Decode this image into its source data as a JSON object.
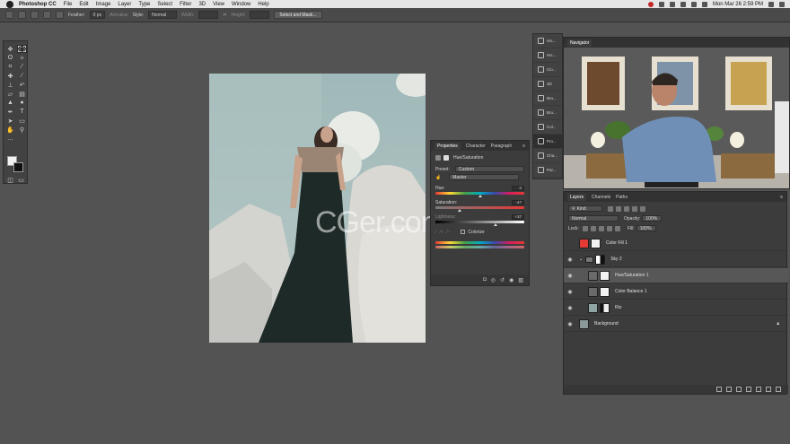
{
  "menubar": {
    "app_name": "Photoshop CC",
    "menus": [
      "File",
      "Edit",
      "Image",
      "Layer",
      "Type",
      "Select",
      "Filter",
      "3D",
      "View",
      "Window",
      "Help"
    ],
    "clock": "Mon Mar 26  2:59 PM"
  },
  "options": {
    "feather_label": "Feather:",
    "feather_value": "0 px",
    "antialias_label": "Anti-alias",
    "style_label": "Style:",
    "style_value": "Normal",
    "width_label": "Width:",
    "height_label": "Height:",
    "mask_button": "Select and Mask..."
  },
  "dock": {
    "items": [
      "His...",
      "His...",
      "Clo...",
      "3D",
      "Bru...",
      "Bru...",
      "Col...",
      "Pro...",
      "Cha...",
      "Par..."
    ]
  },
  "properties": {
    "tabs": [
      "Properties",
      "Character",
      "Paragraph"
    ],
    "title": "Hue/Saturation",
    "preset_label": "Preset:",
    "preset_value": "Custom",
    "channel_value": "Master",
    "hue_label": "Hue:",
    "hue_value": "0",
    "saturation_label": "Saturation:",
    "saturation_value": "-47",
    "lightness_label": "Lightness:",
    "lightness_value": "+37",
    "colorize_label": "Colorize",
    "hue_pos": 0.5,
    "saturation_pos": 0.27,
    "lightness_pos": 0.68
  },
  "navigator": {
    "tab": "Navigator"
  },
  "layers": {
    "tabs": [
      "Layers",
      "Channels",
      "Paths"
    ],
    "kind_label": "Kind",
    "blend_mode": "Normal",
    "opacity_label": "Opacity:",
    "opacity_value": "100%",
    "lock_label": "Lock:",
    "fill_label": "Fill:",
    "fill_value": "100%",
    "rows": [
      "Color Fill 1",
      "Sky 2",
      "Hue/Saturation 1",
      "Color Balance 1",
      "Rtz",
      "Background"
    ]
  },
  "watermark": "CGer.com",
  "colors": {
    "color_fill": "#e53935",
    "selection": "#575757"
  }
}
